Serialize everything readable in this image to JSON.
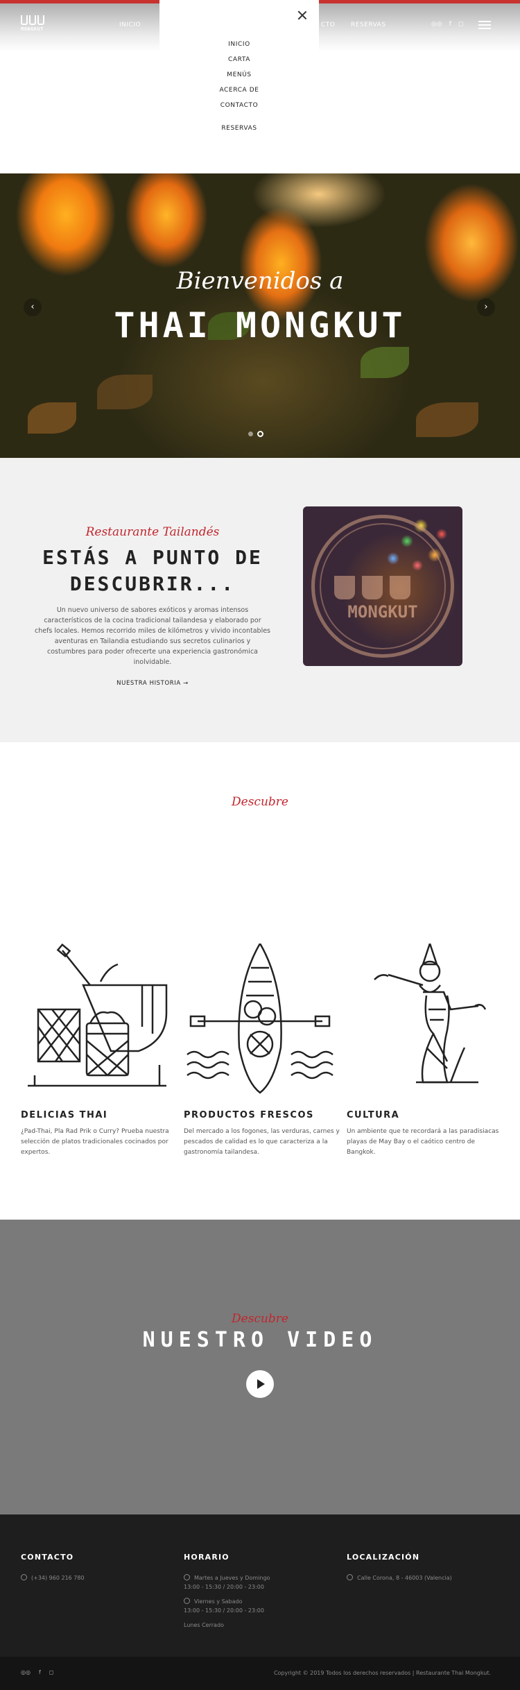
{
  "colors": {
    "accent_red": "#c2262d",
    "header_bar": "#c8322f",
    "video_bg": "#7a7a7a",
    "footer_bg": "#1e1e1e"
  },
  "header": {
    "logo_text": "MONGKUT",
    "nav": {
      "inicio": "INICIO",
      "contacto": "CTO",
      "reservas": "RESERVAS"
    },
    "icons": {
      "tripadvisor": "tripadvisor-icon",
      "facebook": "f",
      "instagram": "instagram-icon"
    }
  },
  "menu": {
    "items": [
      "INICIO",
      "CARTA",
      "MENÚS",
      "ACERCA DE",
      "CONTACTO"
    ],
    "reservas": "RESERVAS"
  },
  "hero": {
    "subtitle": "Bienvenidos a",
    "title": "THAI MONGKUT",
    "prev": "‹",
    "next": "›"
  },
  "intro": {
    "kicker": "Restaurante Tailandés",
    "headline_1": "ESTÁS A PUNTO DE",
    "headline_2": "DESCUBRIR...",
    "body": "Un nuevo universo de sabores exóticos y aromas intensos característicos de la cocina tradicional tailandesa y elaborado por chefs locales. Hemos recorrido miles de kilómetros y vivido incontables aventuras en Tailandia estudiando sus secretos culinarios y costumbres para poder ofrecerte una experiencia gastronómica inolvidable.",
    "more": "NUESTRA HISTORIA  →",
    "photo_mark": "MONGKUT"
  },
  "discover": {
    "title": "Descubre",
    "features": [
      {
        "title": "DELICIAS THAI",
        "text": "¿Pad-Thai, Pla Rad Prik o Curry? Prueba nuestra selección de platos tradicionales cocinados por expertos."
      },
      {
        "title": "PRODUCTOS FRESCOS",
        "text": "Del mercado a los fogones, las verduras, carnes y pescados de calidad es lo que caracteriza a la gastronomía tailandesa."
      },
      {
        "title": "CULTURA",
        "text": "Un ambiente que te recordará a las paradisiacas playas de May Bay o el caótico centro de Bangkok."
      }
    ]
  },
  "video": {
    "kicker": "Descubre",
    "title": "NUESTRO VIDEO"
  },
  "footer": {
    "contacto": {
      "title": "CONTACTO",
      "phone": "(+34) 960 216 780"
    },
    "horario": {
      "title": "HORARIO",
      "line1": "Martes a Jueves y Domingo",
      "line2": "13:00 - 15:30 / 20:00 - 23:00",
      "line3": "Viernes y Sabado",
      "line4": "13:00 - 15:30 / 20:00 - 23:00",
      "line5": "Lunes Cerrado"
    },
    "localizacion": {
      "title": "LOCALIZACIÓN",
      "address": "Calle Corona, 8 - 46003 (Valencia)"
    },
    "copyright": "Copyright © 2019 Todos los derechos reservados | Restaurante Thai Mongkut."
  }
}
